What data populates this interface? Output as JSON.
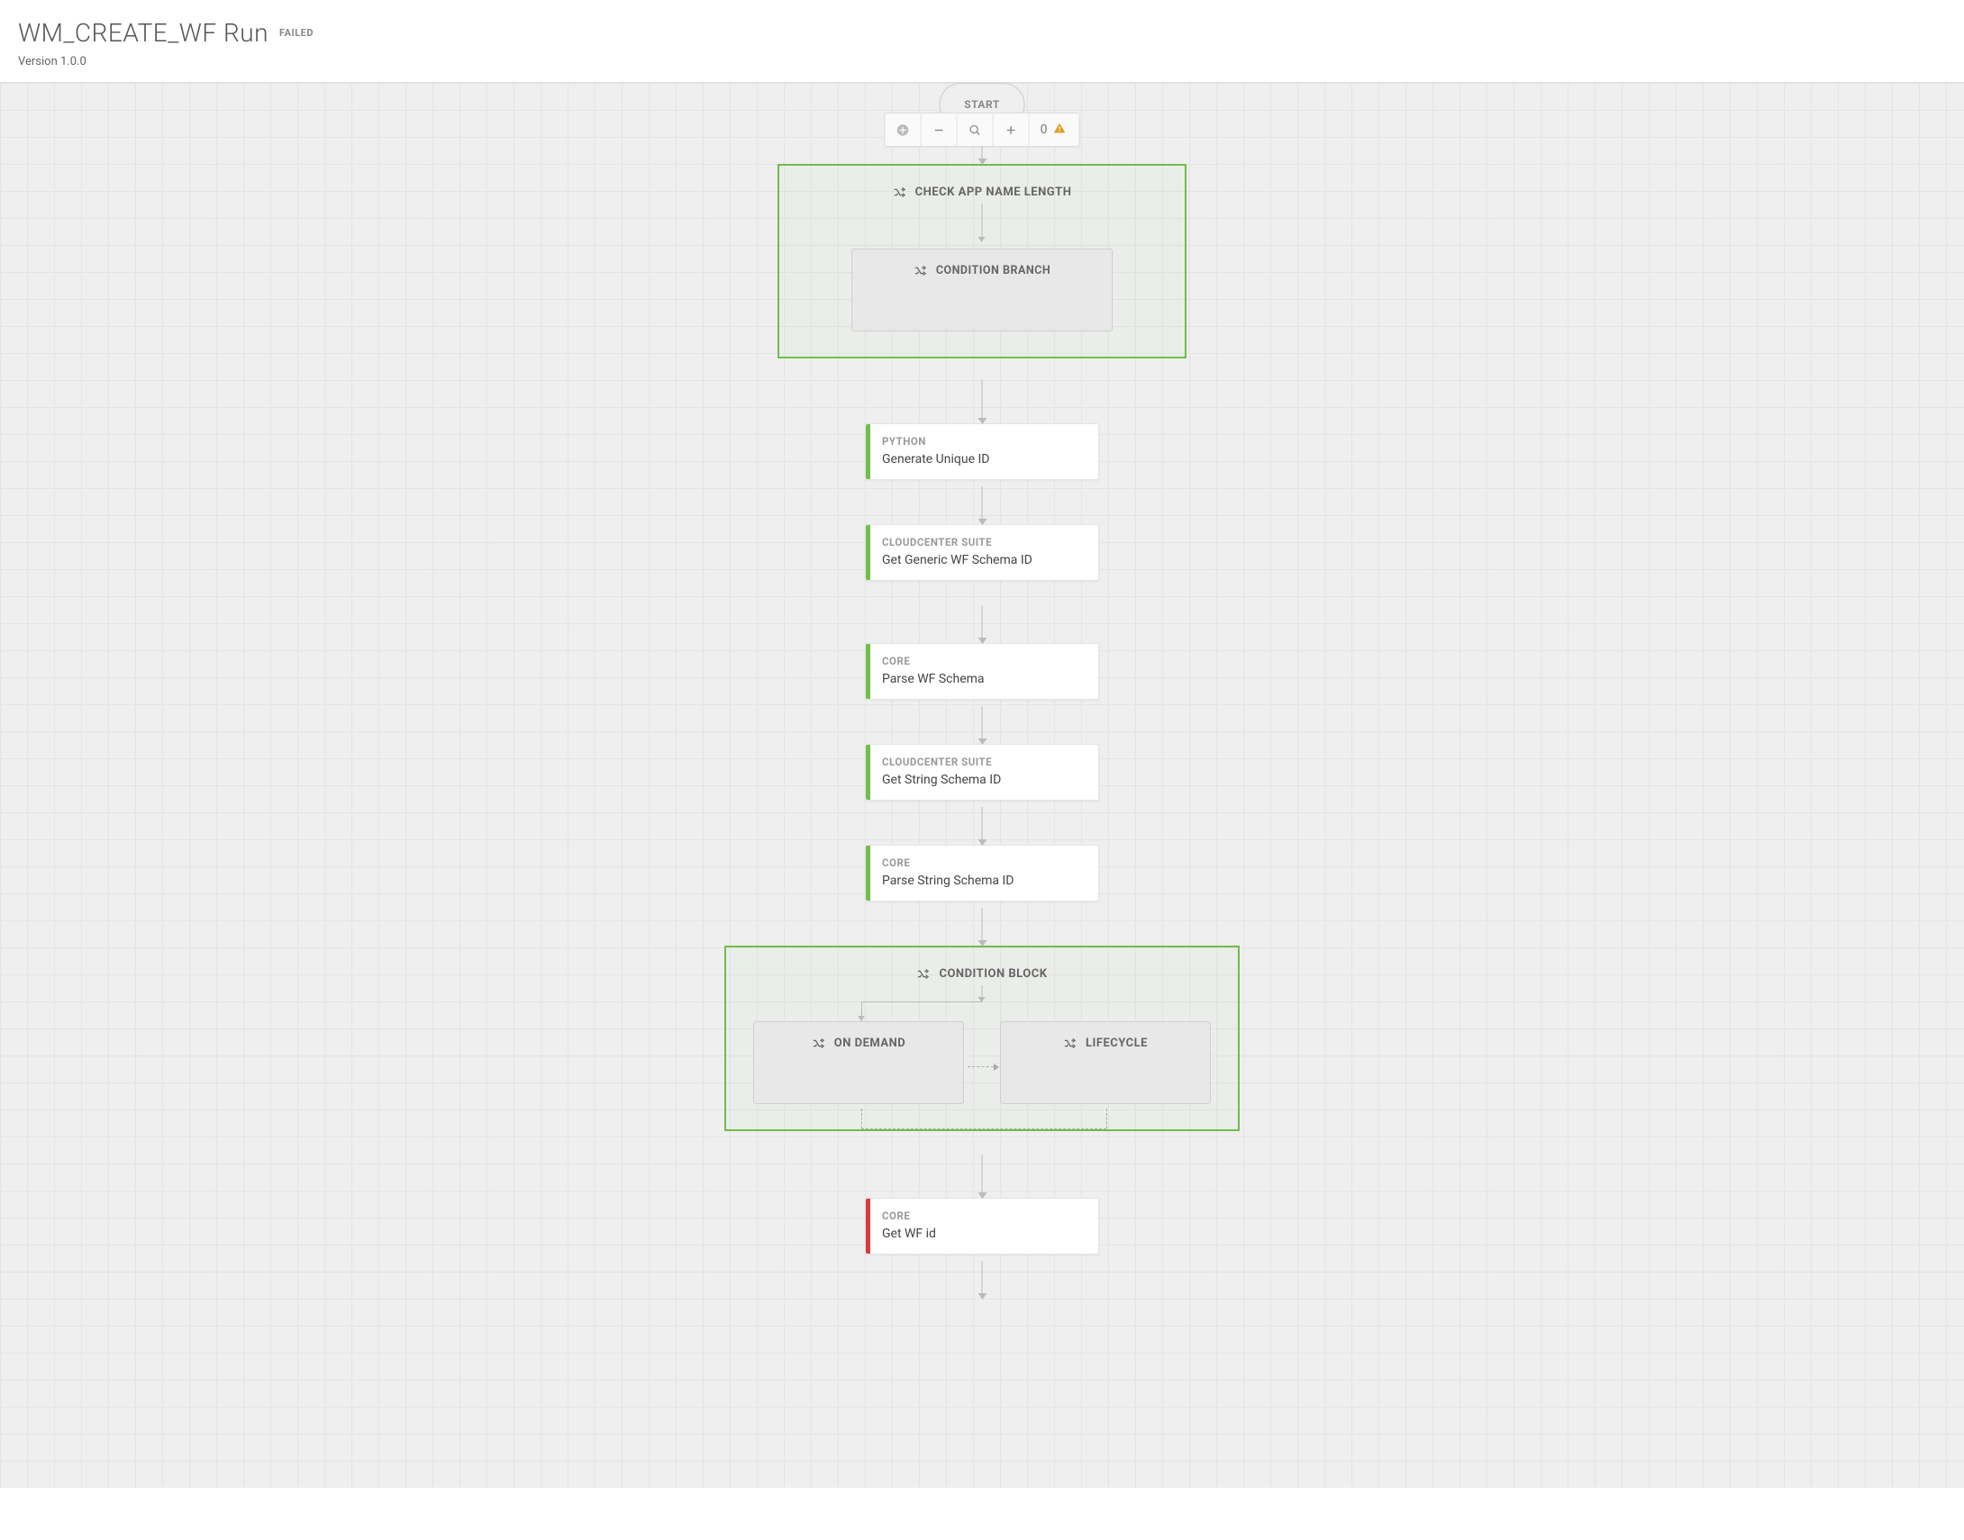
{
  "header": {
    "title": "WM_CREATE_WF Run",
    "status": "FAILED",
    "version": "Version 1.0.0"
  },
  "toolbar": {
    "warning_count": "0"
  },
  "flow": {
    "start_label": "START",
    "cond1": {
      "title": "CHECK APP NAME LENGTH",
      "branch1": "CONDITION BRANCH"
    },
    "task1": {
      "category": "PYTHON",
      "name": "Generate Unique ID"
    },
    "task2": {
      "category": "CLOUDCENTER SUITE",
      "name": "Get Generic WF Schema ID"
    },
    "task3": {
      "category": "CORE",
      "name": "Parse WF Schema"
    },
    "task4": {
      "category": "CLOUDCENTER SUITE",
      "name": "Get String Schema ID"
    },
    "task5": {
      "category": "CORE",
      "name": "Parse String Schema ID"
    },
    "cond2": {
      "title": "CONDITION BLOCK",
      "branch_a": "ON DEMAND",
      "branch_b": "LIFECYCLE"
    },
    "task6": {
      "category": "CORE",
      "name": "Get WF id"
    }
  }
}
